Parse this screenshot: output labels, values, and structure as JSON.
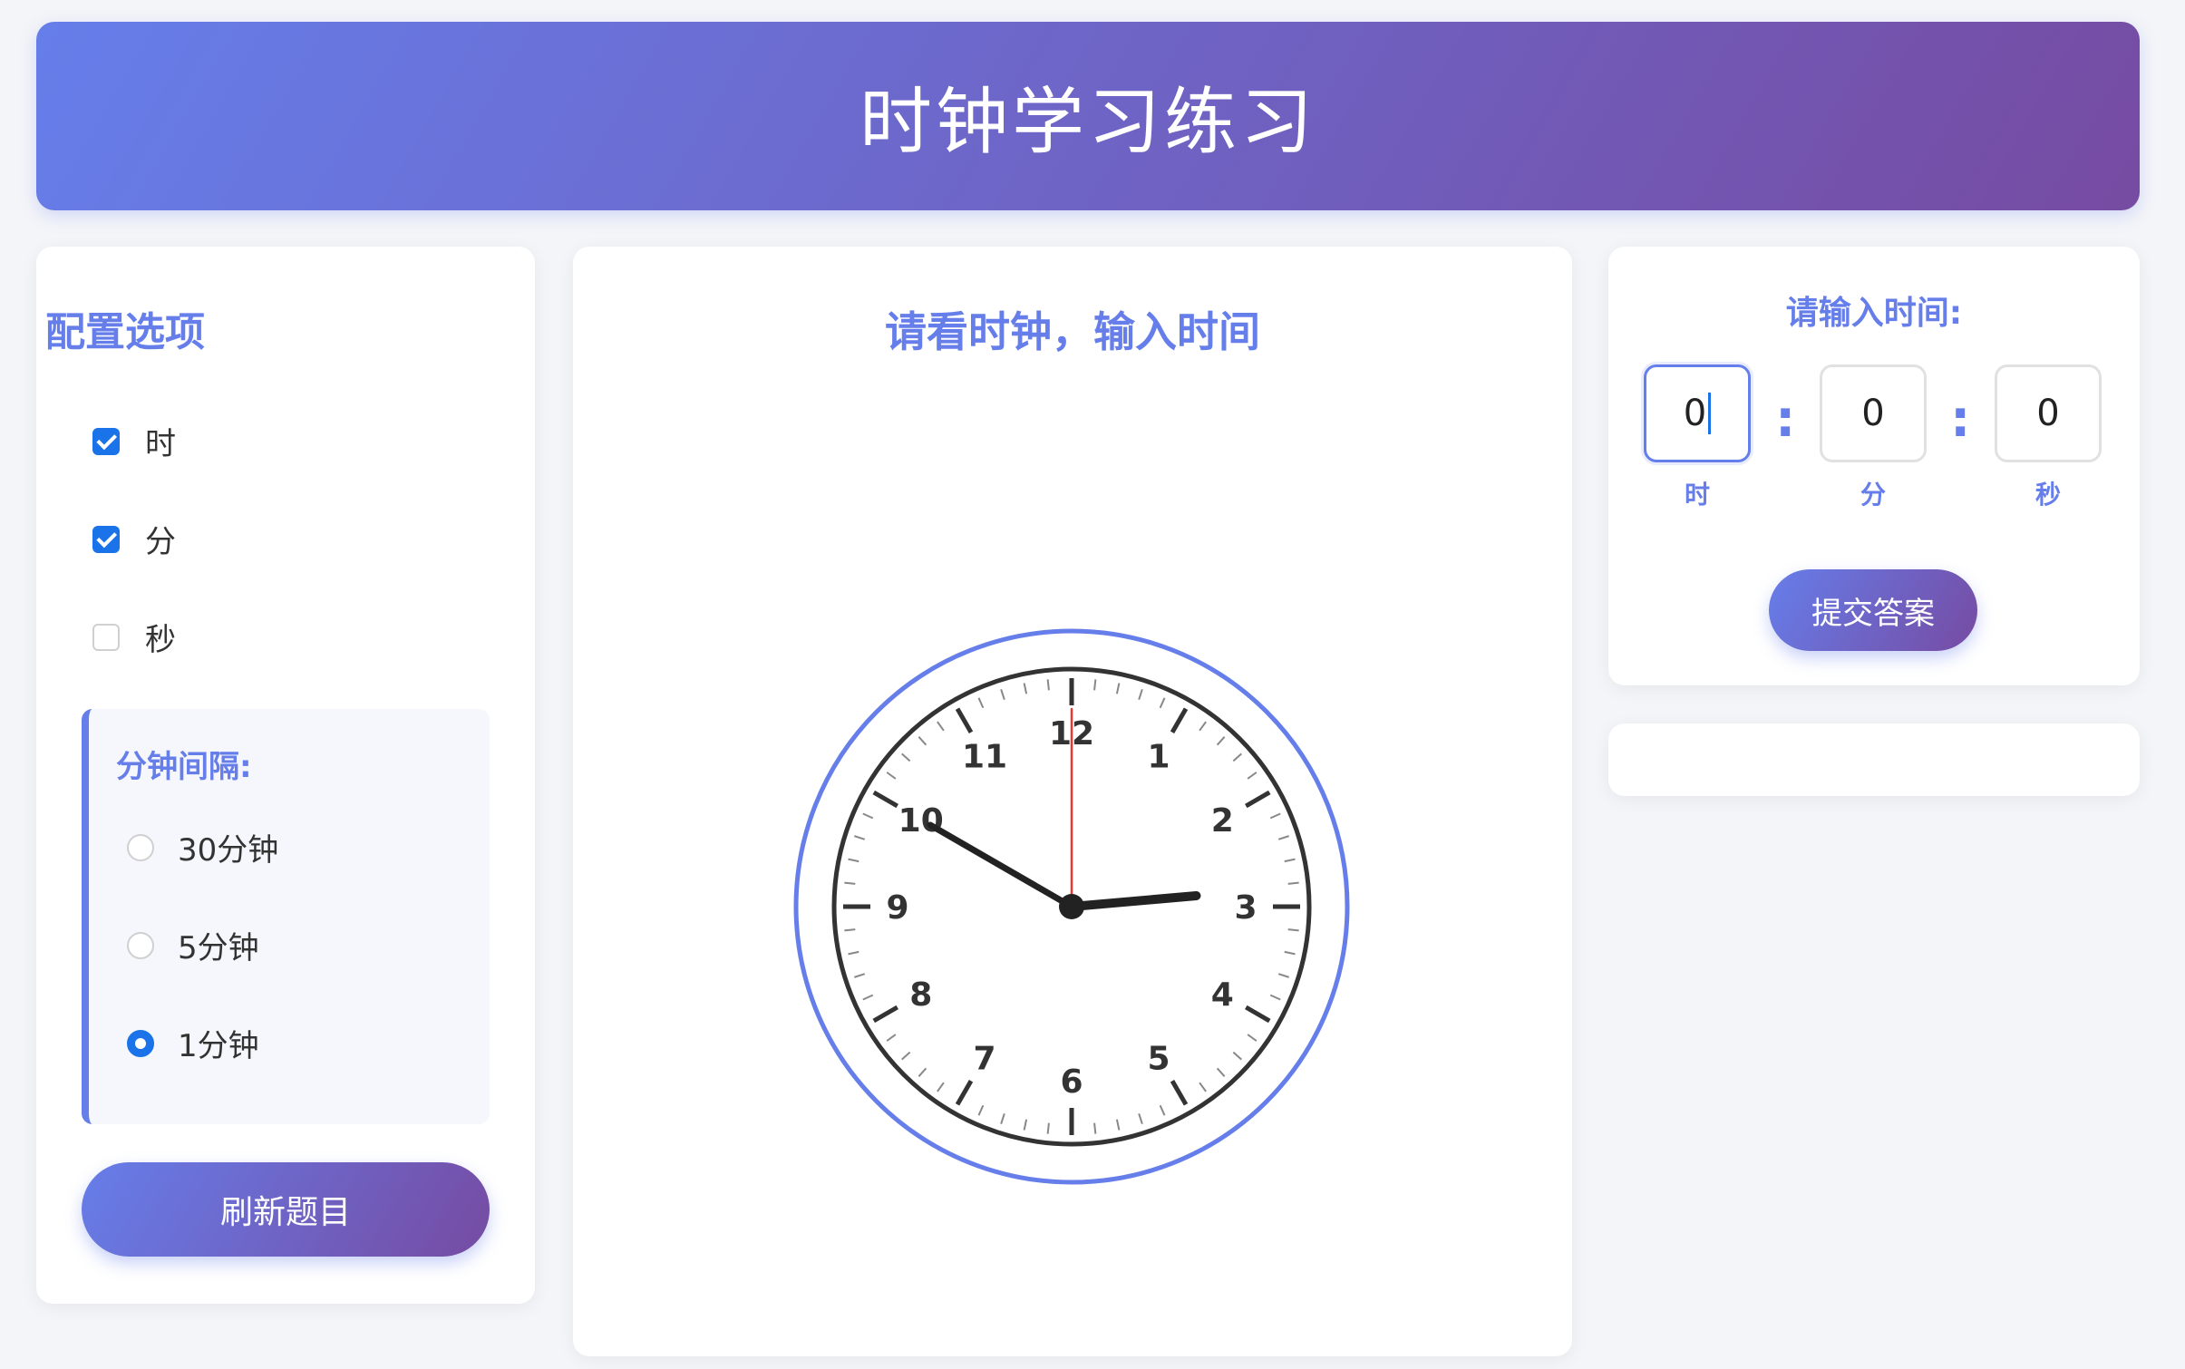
{
  "header": {
    "title": "时钟学习练习"
  },
  "config": {
    "title": "配置选项",
    "options": [
      {
        "label": "时",
        "checked": true
      },
      {
        "label": "分",
        "checked": true
      },
      {
        "label": "秒",
        "checked": false
      }
    ],
    "interval": {
      "title": "分钟间隔:",
      "options": [
        {
          "label": "30分钟",
          "selected": false
        },
        {
          "label": "5分钟",
          "selected": false
        },
        {
          "label": "1分钟",
          "selected": true
        }
      ]
    },
    "refresh_label": "刷新题目"
  },
  "clock": {
    "title": "请看时钟，输入时间",
    "numbers": [
      "12",
      "1",
      "2",
      "3",
      "4",
      "5",
      "6",
      "7",
      "8",
      "9",
      "10",
      "11"
    ],
    "time": {
      "hour": 2,
      "minute": 50,
      "second": 0
    },
    "colors": {
      "ring": "#667eea",
      "face": "#ffffff",
      "hands": "#222222",
      "second_hand": "#e53935"
    }
  },
  "answer": {
    "title": "请输入时间:",
    "hour_value": "0",
    "minute_value": "0",
    "second_value": "0",
    "colon": ":",
    "hour_label": "时",
    "minute_label": "分",
    "second_label": "秒",
    "submit_label": "提交答案"
  },
  "result": {
    "text": ""
  },
  "colors": {
    "accent": "#667eea",
    "accent_end": "#764ba2",
    "checkbox": "#1a73e8"
  }
}
